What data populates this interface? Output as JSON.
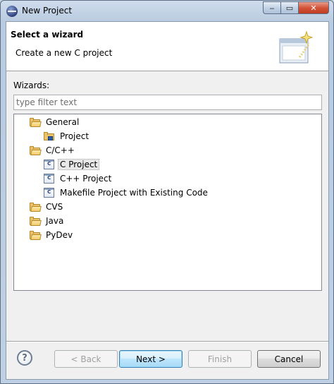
{
  "window": {
    "title": "New Project",
    "controls": {
      "minimize": "‒",
      "maximize": "▭",
      "close": "✕"
    }
  },
  "header": {
    "title": "Select a wizard",
    "description": "Create a new C project",
    "icon": "wizard-sparkle-icon"
  },
  "wizards_label": "Wizards:",
  "filter": {
    "value": "",
    "placeholder": "type filter text"
  },
  "tree": {
    "items": [
      {
        "label": "General",
        "icon": "folder-icon",
        "level": 1
      },
      {
        "label": "Project",
        "icon": "project-icon",
        "level": 2
      },
      {
        "label": "C/C++",
        "icon": "folder-icon",
        "level": 1
      },
      {
        "label": "C Project",
        "icon": "c-project-icon",
        "level": 2,
        "selected": true
      },
      {
        "label": "C++ Project",
        "icon": "c-project-icon",
        "level": 2
      },
      {
        "label": "Makefile Project with Existing Code",
        "icon": "c-project-icon",
        "level": 2
      },
      {
        "label": "CVS",
        "icon": "folder-icon",
        "level": 1
      },
      {
        "label": "Java",
        "icon": "folder-icon",
        "level": 1
      },
      {
        "label": "PyDev",
        "icon": "folder-icon",
        "level": 1
      }
    ]
  },
  "buttons": {
    "help": "?",
    "back": "< Back",
    "next": "Next >",
    "finish": "Finish",
    "cancel": "Cancel"
  },
  "icon_glyph": "C"
}
